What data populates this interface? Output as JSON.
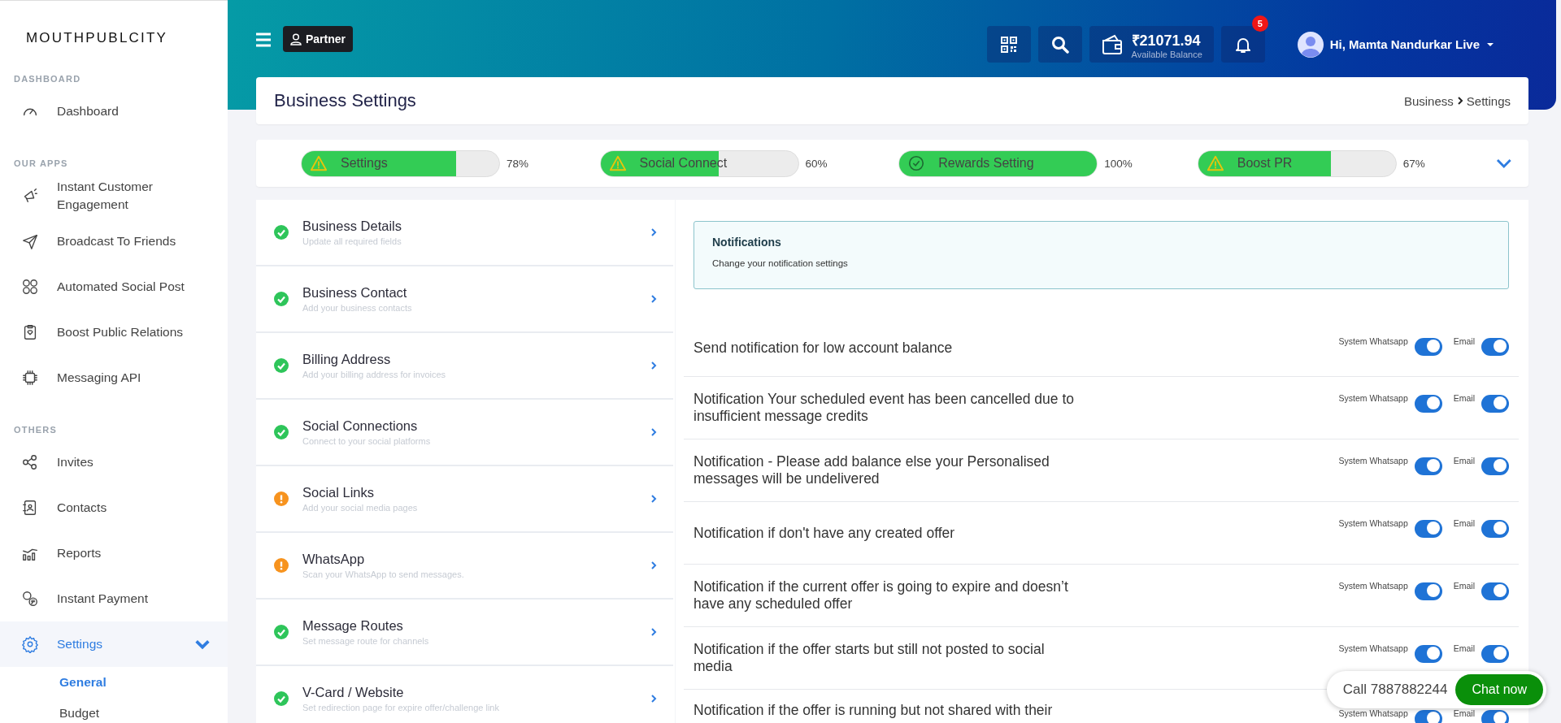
{
  "brand": "MOUTHPUBLCITY",
  "sidebar": {
    "sections": [
      {
        "heading": "DASHBOARD",
        "items": [
          {
            "label": "Dashboard",
            "selected": false
          }
        ]
      },
      {
        "heading": "OUR APPS",
        "items": [
          {
            "label": "Instant Customer Engagement",
            "selected": false
          },
          {
            "label": "Broadcast To Friends",
            "selected": false
          },
          {
            "label": "Automated Social Post",
            "selected": false
          },
          {
            "label": "Boost Public Relations",
            "selected": false
          },
          {
            "label": "Messaging API",
            "selected": false
          }
        ]
      },
      {
        "heading": "OTHERS",
        "items": [
          {
            "label": "Invites",
            "selected": false
          },
          {
            "label": "Contacts",
            "selected": false
          },
          {
            "label": "Reports",
            "selected": false
          },
          {
            "label": "Instant Payment",
            "selected": false
          },
          {
            "label": "Settings",
            "selected": true,
            "expanded": true,
            "children": [
              {
                "label": "General",
                "selected": true
              },
              {
                "label": "Budget",
                "selected": false
              }
            ]
          }
        ]
      }
    ]
  },
  "header": {
    "badge": "Partner",
    "balance": "₹21071.94",
    "balance_caption": "Available Balance",
    "notification_count": "5",
    "user": "Hi, Mamta Nandurkar Live"
  },
  "page": {
    "title": "Business Settings",
    "breadcrumb": [
      "Business",
      "Settings"
    ]
  },
  "progress": [
    {
      "label": "Settings",
      "level": 0.78,
      "percent": "78%",
      "complete": false
    },
    {
      "label": "Social Connect",
      "level": 0.6,
      "percent": "60%",
      "complete": false
    },
    {
      "label": "Rewards Setting",
      "level": 1,
      "percent": "100%",
      "complete": true
    },
    {
      "label": "Boost PR",
      "level": 0.67,
      "percent": "67%",
      "complete": false
    }
  ],
  "steps": [
    {
      "title": "Business Details",
      "subtitle": "Update all required fields",
      "complete": true
    },
    {
      "title": "Business Contact",
      "subtitle": "Add your business contacts",
      "complete": true
    },
    {
      "title": "Billing Address",
      "subtitle": "Add your billing address for invoices",
      "complete": true
    },
    {
      "title": "Social Connections",
      "subtitle": "Connect to your social platforms",
      "complete": true
    },
    {
      "title": "Social Links",
      "subtitle": "Add your social media pages",
      "complete": false
    },
    {
      "title": "WhatsApp",
      "subtitle": "Scan your WhatsApp to send messages.",
      "complete": false
    },
    {
      "title": "Message Routes",
      "subtitle": "Set message route for channels",
      "complete": true
    },
    {
      "title": "V-Card / Website",
      "subtitle": "Set redirection page for expire offer/challenge link",
      "complete": true
    }
  ],
  "notifications": {
    "title": "Notifications",
    "subtitle": "Change your notification settings",
    "rows": [
      {
        "text": "Send notification for low account balance",
        "channels": [
          {
            "label": "System Whatsapp",
            "on": true
          },
          {
            "label": "Email",
            "on": true
          }
        ]
      },
      {
        "text": "Notification Your scheduled event has been cancelled due to insufficient message credits",
        "channels": [
          {
            "label": "System Whatsapp",
            "on": true
          },
          {
            "label": "Email",
            "on": true
          }
        ]
      },
      {
        "text": "Notification - Please add balance else your Personalised messages will be undelivered",
        "channels": [
          {
            "label": "System Whatsapp",
            "on": true
          },
          {
            "label": "Email",
            "on": true
          }
        ]
      },
      {
        "text": "Notification if don't have any created offer",
        "channels": [
          {
            "label": "System Whatsapp",
            "on": true
          },
          {
            "label": "Email",
            "on": true
          }
        ]
      },
      {
        "text": "Notification if the current offer is going to expire and doesn’t have any scheduled offer",
        "channels": [
          {
            "label": "System Whatsapp",
            "on": true
          },
          {
            "label": "Email",
            "on": true
          }
        ]
      },
      {
        "text": "Notification if the offer starts but still not posted to social media",
        "channels": [
          {
            "label": "System Whatsapp",
            "on": true
          },
          {
            "label": "Email",
            "on": true
          }
        ]
      },
      {
        "text": "Notification if the offer is running but not shared with their",
        "channels": [
          {
            "label": "System Whatsapp",
            "on": true
          },
          {
            "label": "Email",
            "on": true
          }
        ]
      }
    ]
  },
  "chat": {
    "call": "Call 7887882244",
    "button": "Chat now"
  }
}
